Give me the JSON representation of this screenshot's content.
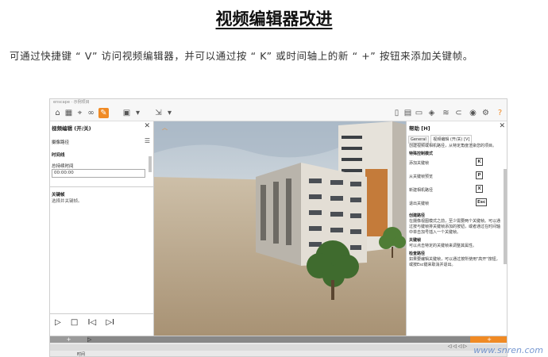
{
  "document": {
    "title": "视频编辑器改进",
    "paragraph": "可通过快捷键 “ V” 访问视频编辑器，并可以通过按 “ K” 或时间轴上的新 “ +” 按钮来添加关键帧。"
  },
  "screenshot": {
    "app_title": "enscape · 示例项目",
    "left_panel": {
      "title": "视频编辑 (开/关)",
      "tab": "摄像路径",
      "section_time": "时间线",
      "time_label": "总持续时间",
      "time_value": "00:00:00",
      "section_keyframe": "关键帧",
      "keyframe_hint": "选择并关键帧。",
      "controls": [
        "▷",
        "□",
        "I◁",
        "▷I"
      ]
    },
    "right_panel": {
      "title": "帮助 [H]",
      "tabs": [
        "General",
        "视频编辑 (开/关) [V]"
      ],
      "intro": "创建视频或相机路径，从特定角度渲染您的项目。",
      "shortcuts_title": "特殊控制模式",
      "shortcuts": [
        {
          "label": "添加关键帧",
          "key": "K"
        },
        {
          "label": "从关键帧预览",
          "key": "P"
        },
        {
          "label": "新建相机路径",
          "key": "X"
        },
        {
          "label": "退出关键帧",
          "key": "Esc"
        }
      ],
      "create_title": "创建路径",
      "create_text": "在摄像视图模式之前，至少需要两个关键帧。可以通过按与键帧排关键帧添加的按钮，或者通过在时间轴中单击加号插入一个关键帧。",
      "keyframe_title": "关键帧",
      "keyframe_text": "可以点击特定的关键帧来调整其属性。",
      "edit_title": "检查路径",
      "edit_text": "如果要编辑关键帧，可以通过按所使用\"高开\"按钮，或按Esc键来取消并退出。"
    },
    "timeline": {
      "add_left": "+",
      "add_right": "+",
      "row_label": "时间",
      "nav": "◁ ◁ ◁ ▷"
    }
  },
  "watermark": "www.snren.com",
  "colors": {
    "accent": "#f08a24",
    "sky": "#c9d7e3",
    "ground": "#b7a489"
  }
}
